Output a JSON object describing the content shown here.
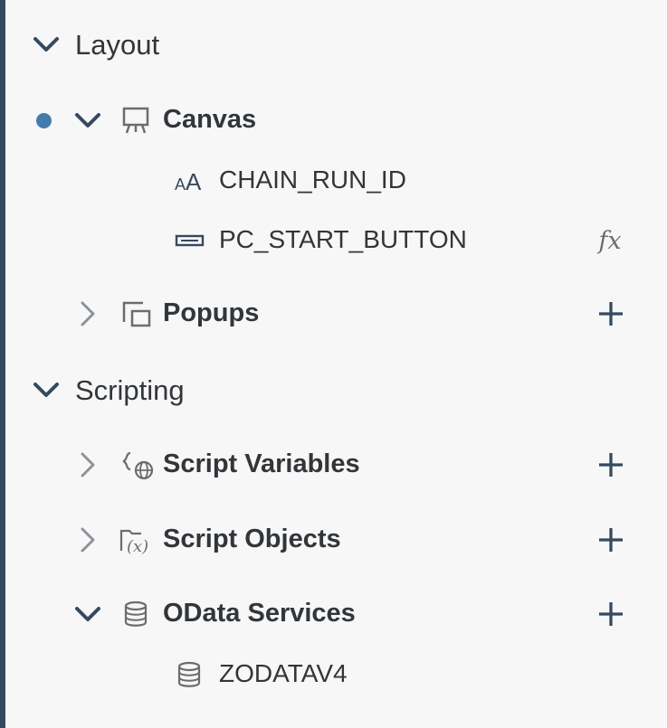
{
  "sections": {
    "layout": {
      "label": "Layout",
      "canvas": {
        "label": "Canvas",
        "children": [
          {
            "label": "CHAIN_RUN_ID"
          },
          {
            "label": "PC_START_BUTTON",
            "action": "fx"
          }
        ]
      },
      "popups": {
        "label": "Popups",
        "action": "+"
      }
    },
    "scripting": {
      "label": "Scripting",
      "script_variables": {
        "label": "Script Variables",
        "action": "+"
      },
      "script_objects": {
        "label": "Script Objects",
        "action": "+"
      },
      "odata_services": {
        "label": "OData Services",
        "action": "+",
        "children": [
          {
            "label": "ZODATAV4"
          }
        ]
      }
    }
  },
  "colors": {
    "text": "#32363a",
    "icon": "#6a6d70",
    "accent": "#427cac",
    "dark_chevron": "#354a5f",
    "left_bar": "#354a5f",
    "background": "#f7f7f7"
  }
}
